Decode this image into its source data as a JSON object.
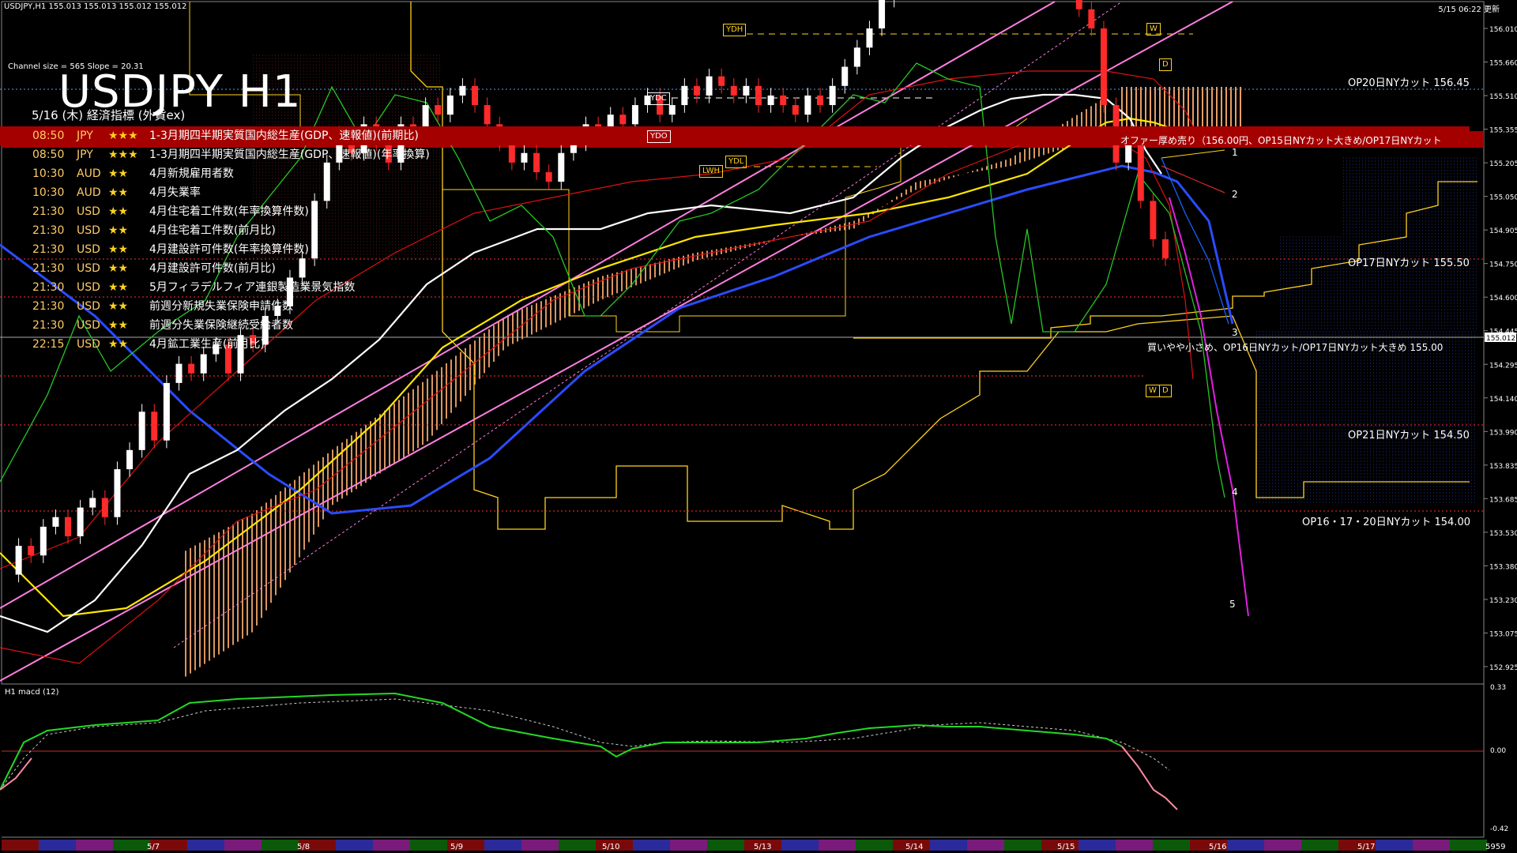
{
  "header": {
    "symbol_info": "USDJPY,H1  155.013 155.013 155.012 155.012",
    "datetime": "5/15 06:22 更新",
    "channel_info": "Channel size = 565 Slope = 20.31",
    "title": "USDJPY H1",
    "subtitle": "5/16 (木) 経済指標 (外貨ex)"
  },
  "events": [
    {
      "time": "08:50",
      "currency": "JPY",
      "stars": "★★★",
      "text": "1-3月期四半期実質国内総生産(GDP、速報値)(前期比)",
      "highlight": true
    },
    {
      "time": "08:50",
      "currency": "JPY",
      "stars": "★★★",
      "text": "1-3月期四半期実質国内総生産(GDP、速報値)(年率換算)",
      "highlight": false
    },
    {
      "time": "10:30",
      "currency": "AUD",
      "stars": "★★",
      "text": "4月新規雇用者数",
      "highlight": false
    },
    {
      "time": "10:30",
      "currency": "AUD",
      "stars": "★★",
      "text": "4月失業率",
      "highlight": false
    },
    {
      "time": "21:30",
      "currency": "USD",
      "stars": "★★",
      "text": "4月住宅着工件数(年率換算件数)",
      "highlight": false
    },
    {
      "time": "21:30",
      "currency": "USD",
      "stars": "★★",
      "text": "4月住宅着工件数(前月比)",
      "highlight": false
    },
    {
      "time": "21:30",
      "currency": "USD",
      "stars": "★★",
      "text": "4月建設許可件数(年率換算件数)",
      "highlight": false
    },
    {
      "time": "21:30",
      "currency": "USD",
      "stars": "★★",
      "text": "4月建設許可件数(前月比)",
      "highlight": false
    },
    {
      "time": "21:30",
      "currency": "USD",
      "stars": "★★",
      "text": "5月フィラデルフィア連銀製造業景気指数",
      "highlight": false
    },
    {
      "time": "21:30",
      "currency": "USD",
      "stars": "★★",
      "text": "前週分新規失業保険申請件数",
      "highlight": false
    },
    {
      "time": "21:30",
      "currency": "USD",
      "stars": "★★",
      "text": "前週分失業保険継続受給者数",
      "highlight": false
    },
    {
      "time": "22:15",
      "currency": "USD",
      "stars": "★★",
      "text": "4月鉱工業生産(前月比)",
      "highlight": false
    }
  ],
  "annotations": {
    "op20": "OP20日NYカット 156.45",
    "sell": "オファー厚め売り（156.00円、OP15日NYカット大きめ/OP17日NYカット",
    "op17": "OP17日NYカット 155.50",
    "buy": "買いやや小さめ、OP16日NYカット/OP17日NYカット大きめ 155.00",
    "op21": "OP21日NYカット 154.50",
    "op16": "OP16・17・20日NYカット 154.00"
  },
  "boxes": {
    "ydh": "YDH",
    "ydc": "YDC",
    "ydo": "YDO",
    "ydl": "YDL",
    "lwh": "LWH",
    "w1": "W",
    "d1": "D",
    "w2": "W",
    "d2": "D"
  },
  "counts": [
    "1",
    "2",
    "3",
    "4",
    "5"
  ],
  "macd_label": "H1  macd (12)",
  "bottom_num": "5959",
  "colors": {
    "bull": "#ffffff",
    "bear": "#ff2a2a",
    "kumo_up": "#ffb070",
    "kumo_dn": "#3a5cff",
    "band": "#a50000"
  },
  "chart_data": {
    "type": "candlestick",
    "ylim": [
      152.87,
      156.2
    ],
    "y_ticks": [
      156.01,
      155.66,
      155.51,
      155.36,
      155.21,
      155.05,
      154.9,
      154.75,
      154.6,
      154.45,
      154.3,
      154.15,
      154.0,
      153.84,
      153.69,
      153.54,
      153.39,
      153.24,
      153.08,
      152.93
    ],
    "y_tick_labels": [
      "156.010",
      "155.660",
      "155.510",
      "155.355",
      "155.205",
      "155.050",
      "154.905",
      "154.750",
      "154.600",
      "154.445",
      "154.295",
      "154.140",
      "153.990",
      "153.835",
      "153.685",
      "153.530",
      "153.380",
      "153.230",
      "153.075",
      "152.925"
    ],
    "current_price": "155.012",
    "date_labels": [
      "5/7",
      "5/8",
      "5/9",
      "5/10",
      "5/13",
      "5/14",
      "5/15",
      "5/16",
      "5/17"
    ],
    "macd_ticks": [
      "0.33",
      "0.00",
      "-0.42"
    ],
    "price_path": [
      153.35,
      153.5,
      153.45,
      153.6,
      153.65,
      153.55,
      153.7,
      153.75,
      153.65,
      153.9,
      154.0,
      154.2,
      154.05,
      154.35,
      154.45,
      154.4,
      154.5,
      154.55,
      154.4,
      154.6,
      154.55,
      154.7,
      154.75,
      154.9,
      155.0,
      155.3,
      155.5,
      155.65,
      155.55,
      155.7,
      155.6,
      155.5,
      155.7,
      155.65,
      155.8,
      155.75,
      155.85,
      155.9,
      155.8,
      155.7,
      155.6,
      155.5,
      155.55,
      155.45,
      155.4,
      155.55,
      155.6,
      155.7,
      155.65,
      155.75,
      155.7,
      155.8,
      155.85,
      155.75,
      155.8,
      155.9,
      155.85,
      155.95,
      155.9,
      155.85,
      155.9,
      155.8,
      155.85,
      155.8,
      155.75,
      155.85,
      155.8,
      155.9,
      156.0,
      156.1,
      156.2,
      156.35,
      156.4,
      156.45,
      156.5,
      156.45,
      156.55,
      156.5,
      156.6,
      156.45,
      156.5,
      156.55,
      156.5,
      156.45,
      156.5,
      156.45,
      156.4,
      156.3,
      156.2,
      155.8,
      155.5,
      155.6,
      155.3,
      155.1,
      155.0
    ]
  }
}
